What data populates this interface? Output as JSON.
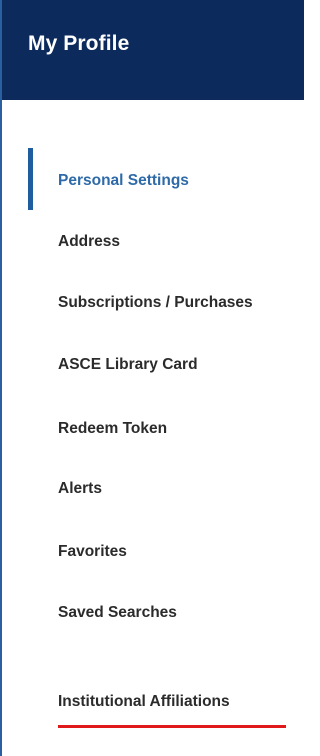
{
  "header": {
    "title": "My Profile"
  },
  "nav": {
    "items": [
      {
        "label": "Personal Settings"
      },
      {
        "label": "Address"
      },
      {
        "label": "Subscriptions / Purchases"
      },
      {
        "label": "ASCE Library Card"
      },
      {
        "label": "Redeem Token"
      },
      {
        "label": "Alerts"
      },
      {
        "label": "Favorites"
      },
      {
        "label": "Saved Searches"
      },
      {
        "label": "Institutional Affiliations"
      }
    ]
  },
  "colors": {
    "header_bg": "#0c2a5c",
    "active_text": "#2f6aa8",
    "active_bar": "#1f5d9e",
    "highlight_underline": "#e01a1a"
  }
}
